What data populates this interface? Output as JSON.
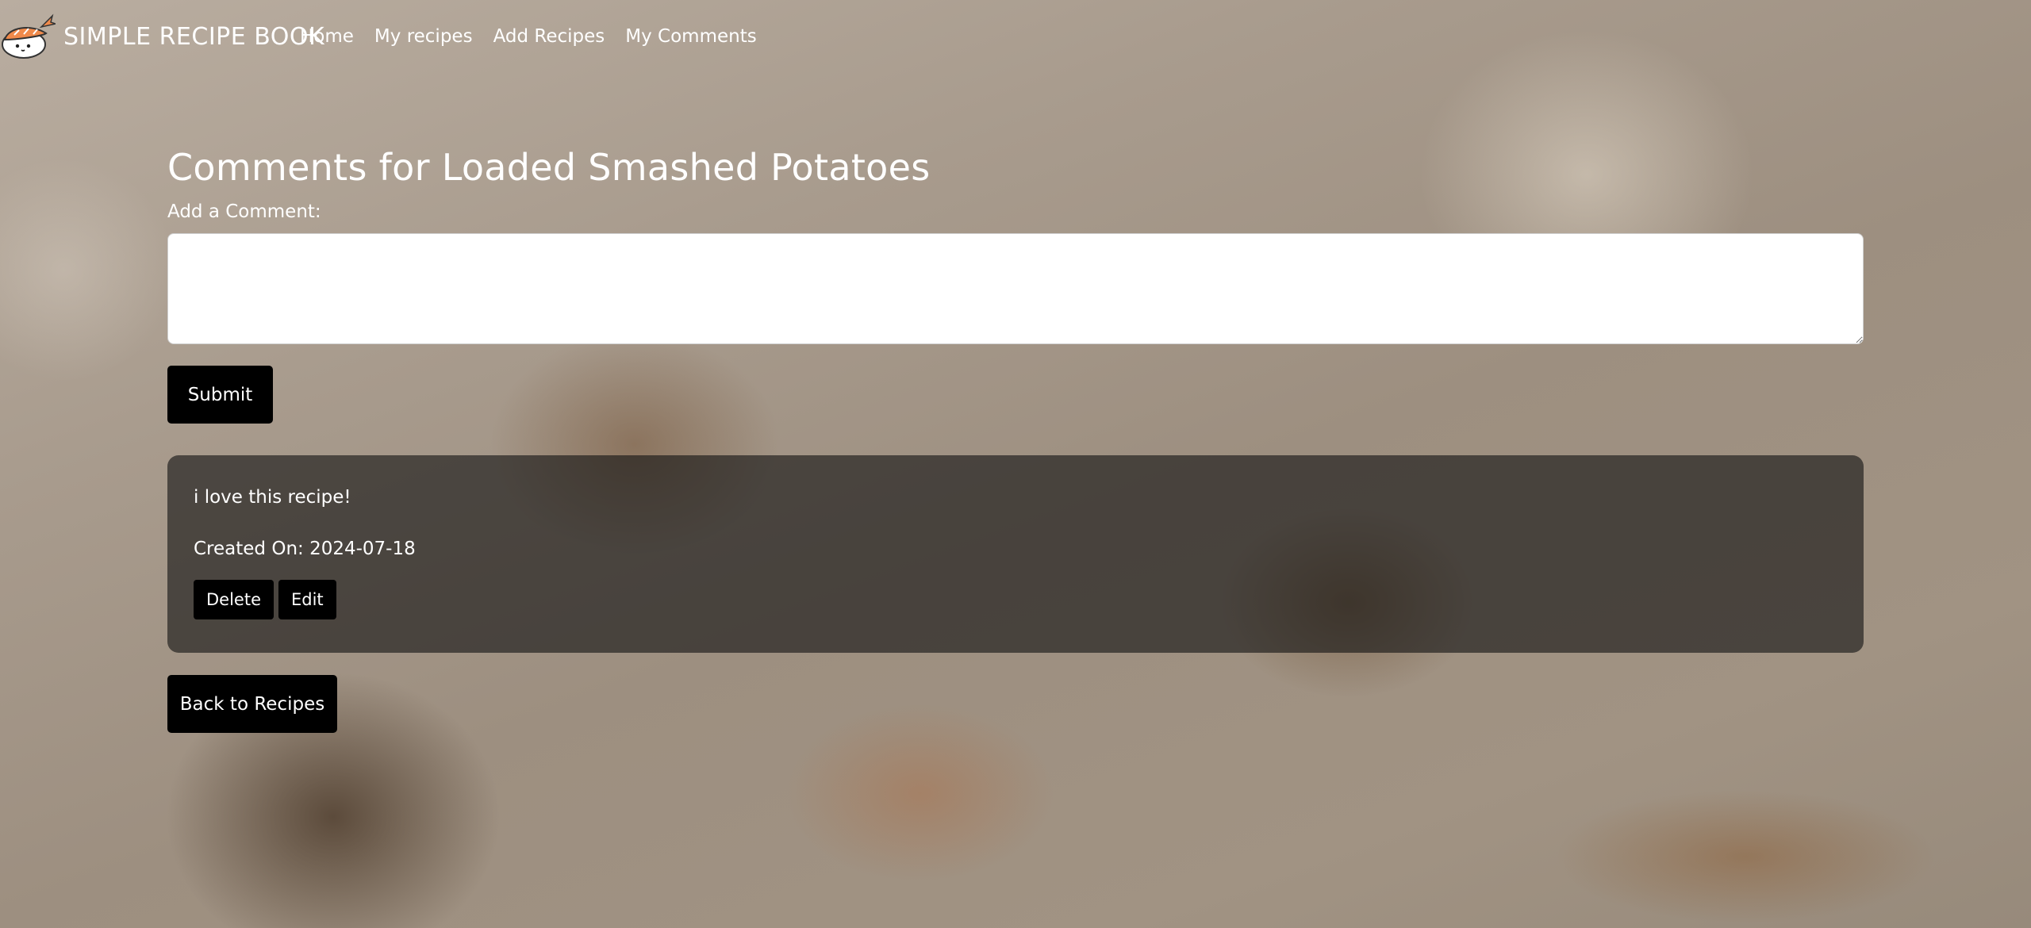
{
  "brand": {
    "logo_icon": "sushi-icon",
    "title": "SIMPLE RECIPE BOOK"
  },
  "nav": {
    "items": [
      {
        "label": "Home"
      },
      {
        "label": "My recipes"
      },
      {
        "label": "Add Recipes"
      },
      {
        "label": "My Comments"
      }
    ]
  },
  "page": {
    "title": "Comments for Loaded Smashed Potatoes",
    "add_comment_label": "Add a Comment:",
    "comment_input_value": "",
    "submit_label": "Submit",
    "back_label": "Back to Recipes"
  },
  "comments": [
    {
      "text": "i love this recipe!",
      "created": "Created On: 2024-07-18",
      "delete_label": "Delete",
      "edit_label": "Edit"
    }
  ],
  "colors": {
    "button_bg": "#000000",
    "card_bg": "rgba(20,20,20,0.62)",
    "text": "#ffffff"
  }
}
